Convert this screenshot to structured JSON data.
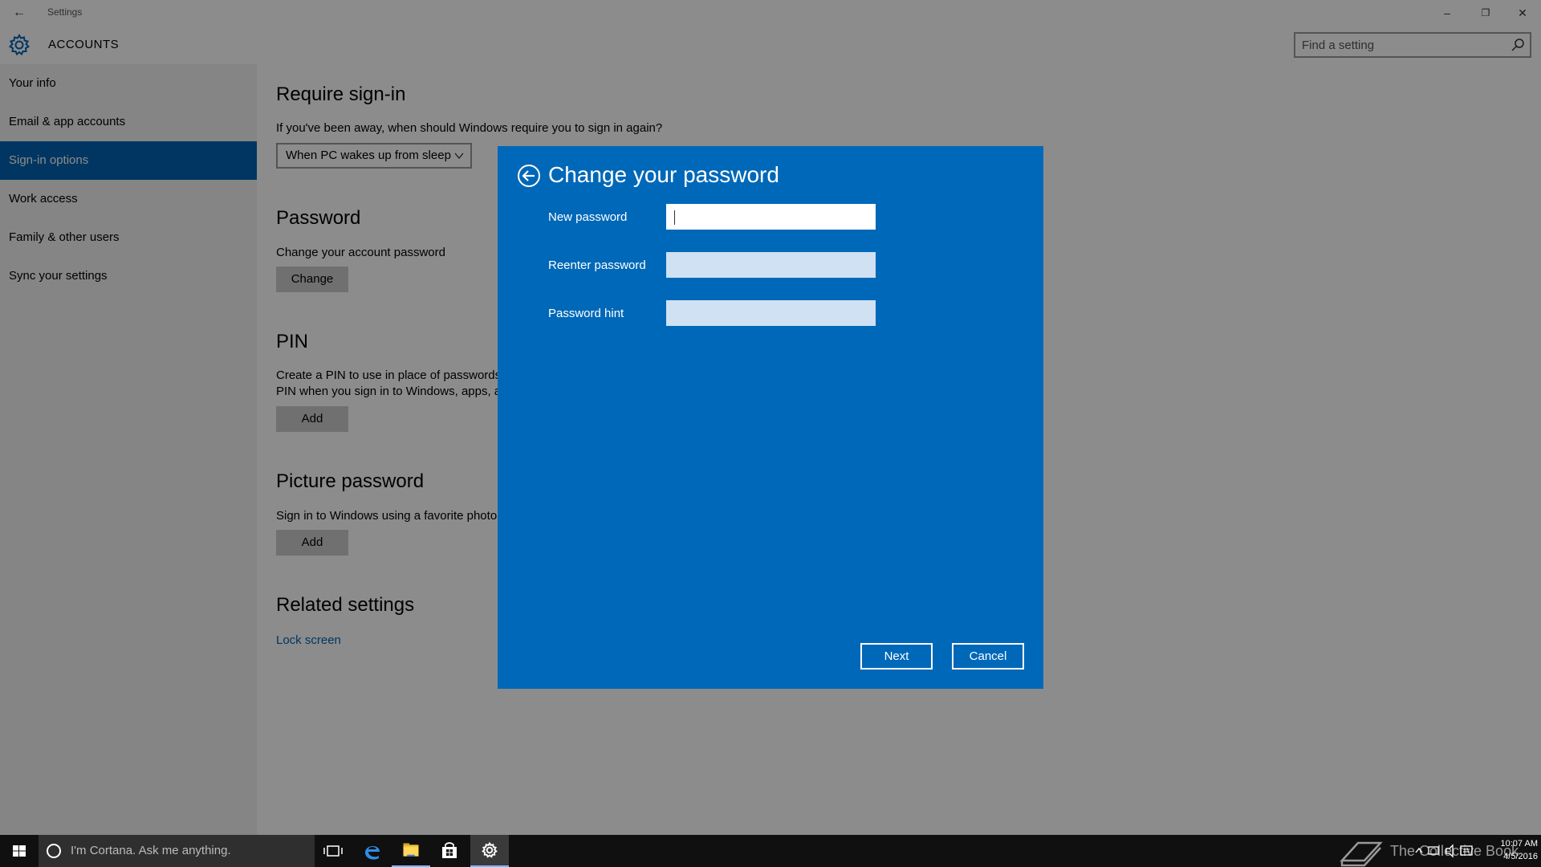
{
  "window": {
    "title": "Settings",
    "back_glyph": "←",
    "minimize_glyph": "–",
    "restore_glyph": "❐",
    "close_glyph": "✕"
  },
  "header": {
    "title": "ACCOUNTS",
    "search_placeholder": "Find a setting"
  },
  "sidebar": {
    "items": [
      {
        "label": "Your info"
      },
      {
        "label": "Email & app accounts"
      },
      {
        "label": "Sign-in options"
      },
      {
        "label": "Work access"
      },
      {
        "label": "Family & other users"
      },
      {
        "label": "Sync your settings"
      }
    ],
    "active_index": 2
  },
  "content": {
    "require_signin": {
      "heading": "Require sign-in",
      "description": "If you've been away, when should Windows require you to sign in again?",
      "dropdown_value": "When PC wakes up from sleep"
    },
    "password": {
      "heading": "Password",
      "description": "Change your account password",
      "button": "Change"
    },
    "pin": {
      "heading": "PIN",
      "description_line1": "Create a PIN to use in place of passwords.",
      "description_line2": "PIN when you sign in to Windows, apps, a",
      "button": "Add"
    },
    "picture_password": {
      "heading": "Picture password",
      "description": "Sign in to Windows using a favorite photo",
      "button": "Add"
    },
    "related": {
      "heading": "Related settings",
      "link": "Lock screen"
    }
  },
  "dialog": {
    "title": "Change your password",
    "fields": [
      {
        "label": "New password",
        "value": ""
      },
      {
        "label": "Reenter password",
        "value": ""
      },
      {
        "label": "Password hint",
        "value": ""
      }
    ],
    "next_button": "Next",
    "cancel_button": "Cancel"
  },
  "taskbar": {
    "cortana_text": "I'm Cortana. Ask me anything.",
    "watermark": "The Collective Book",
    "time": "10:07 AM",
    "date": "4/5/2016"
  },
  "colors": {
    "accent": "#0063b1",
    "dialog_bg": "#0068b8",
    "taskbar_bg": "#101010"
  },
  "icons": {
    "settings": "gear-icon",
    "search": "search-icon",
    "dialog_back": "back-arrow-circle-icon",
    "start": "windows-logo-icon",
    "edge": "edge-icon",
    "explorer": "folder-icon",
    "store": "store-icon"
  }
}
